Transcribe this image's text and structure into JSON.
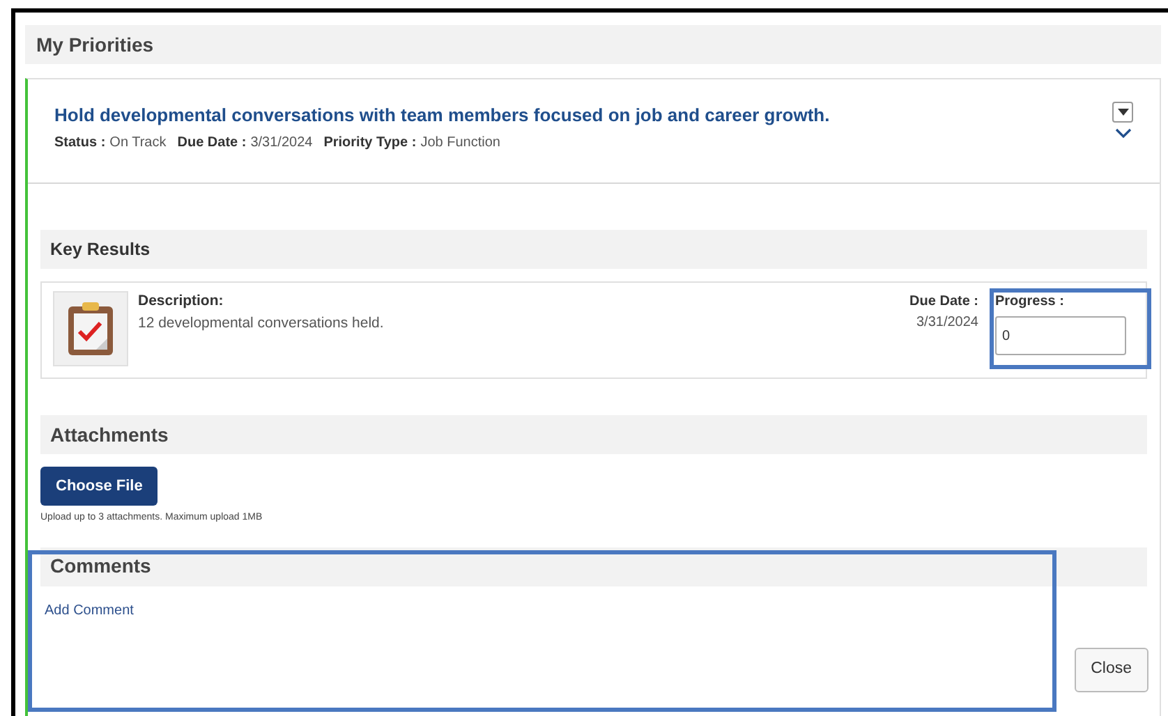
{
  "page_title": "My Priorities",
  "priority": {
    "title": "Hold developmental conversations with team members focused on job and career growth.",
    "meta": [
      {
        "label": "Status :",
        "value": "On Track"
      },
      {
        "label": "Due Date :",
        "value": "3/31/2024"
      },
      {
        "label": "Priority Type :",
        "value": "Job Function"
      }
    ],
    "expanded": true
  },
  "key_results": {
    "heading": "Key Results",
    "description_label": "Description:",
    "description": "12 developmental conversations held.",
    "due_label": "Due Date :",
    "due": "3/31/2024",
    "progress_label": "Progress :",
    "progress_value": "0"
  },
  "attachments": {
    "heading": "Attachments",
    "button": "Choose File",
    "note": "Upload up to 3 attachments. Maximum upload 1MB"
  },
  "comments": {
    "heading": "Comments",
    "link": "Add Comment"
  },
  "close_button": "Close"
}
